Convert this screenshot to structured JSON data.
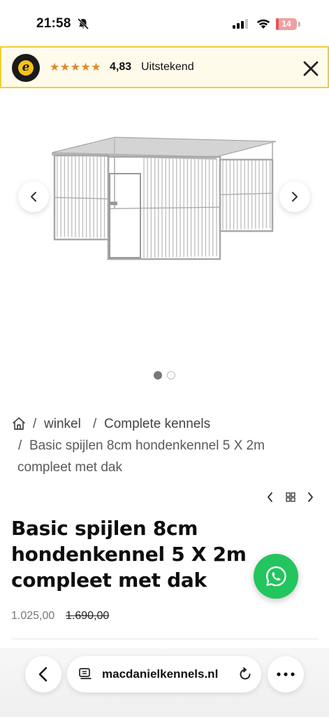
{
  "status_bar": {
    "time": "21:58",
    "battery_level": "14",
    "battery_fraction": 0.14
  },
  "trust_banner": {
    "stars": "★★★★★",
    "rating": "4,83",
    "rating_label": "Uitstekend",
    "logo_letter": "e",
    "colors": {
      "background": "#fffbea",
      "border": "#f2cf2c",
      "stars": "#e08a2a"
    }
  },
  "gallery": {
    "image_alt": "Basic spijlen 8cm hondenkennel 5 X 2m compleet met dak",
    "active_index": 1,
    "total": 2
  },
  "breadcrumb": {
    "sep": "/",
    "items": [
      "winkel",
      "Complete kennels"
    ],
    "current_line1": "Basic spijlen 8cm hondenkennel 5 X 2m",
    "current_line2": "compleet met dak"
  },
  "product": {
    "title_line1": "Basic spijlen 8cm",
    "title_line2": "hondenkennel 5 X 2m",
    "title_line3": "compleet met dak",
    "price": "1.025,00",
    "price_old": "1.690,00"
  },
  "browser": {
    "url": "macdanielkennels.nl"
  },
  "icons": {
    "home": "home-icon",
    "close": "close-icon",
    "whatsapp": "whatsapp-icon",
    "reload": "reload-icon",
    "more": "more-icon"
  },
  "colors": {
    "whatsapp_green": "#22c55e",
    "battery_red": "#e0575b"
  }
}
